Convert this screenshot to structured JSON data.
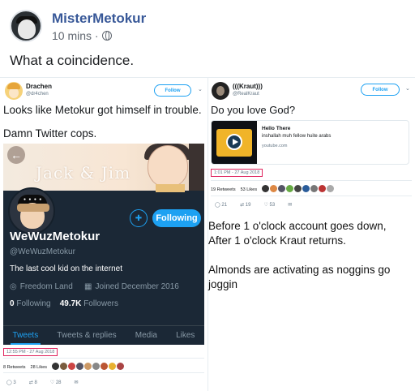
{
  "post": {
    "author": "MisterMetokur",
    "time": "10 mins ·",
    "text": "What a coincidence."
  },
  "left_tweet": {
    "name": "Drachen",
    "handle": "@dr4chen",
    "follow_label": "Follow",
    "text_line1": "Looks like Metokur got himself in trouble.",
    "text_line2": "Damn Twitter cops.",
    "timestamp": "12:55 PM - 27 Aug 2018",
    "retweets": "8 Retweets",
    "likes": "28 Likes",
    "replies_count": "3",
    "retweet_count": "8",
    "like_count": "28",
    "profile": {
      "banner_text": "Jack & Jim",
      "name": "WeWuzMetokur",
      "handle": "@WeWuzMetokur",
      "bio": "The last cool kid on the internet",
      "location": "Freedom Land",
      "joined": "Joined December 2016",
      "following_count": "0",
      "following_label": "Following",
      "followers_count": "49.7K",
      "followers_label": "Followers",
      "following_button": "Following",
      "tabs": [
        "Tweets",
        "Tweets & replies",
        "Media",
        "Likes"
      ]
    }
  },
  "right_tweet": {
    "name": "(((Kraut)))",
    "handle": "@RealKraut",
    "follow_label": "Follow",
    "text": "Do you love God?",
    "card_title": "Hello There",
    "card_desc": "inshallah muh fellow huite arabs",
    "card_domain": "youtube.com",
    "timestamp": "1:01 PM - 27 Aug 2018",
    "retweets": "19 Retweets",
    "likes": "53 Likes",
    "replies_count": "21",
    "retweet_count": "19",
    "like_count": "53"
  },
  "comment": {
    "line1": "Before 1 o'clock account goes down,",
    "line2": "After 1 o'clock Kraut returns.",
    "line3": "Almonds are activating as noggins go",
    "line4": "joggin"
  },
  "colors": {
    "facebook_link": "#385898",
    "twitter_blue": "#1da1f2",
    "profile_bg": "#1b2836",
    "timestamp_border": "#e0245e"
  }
}
